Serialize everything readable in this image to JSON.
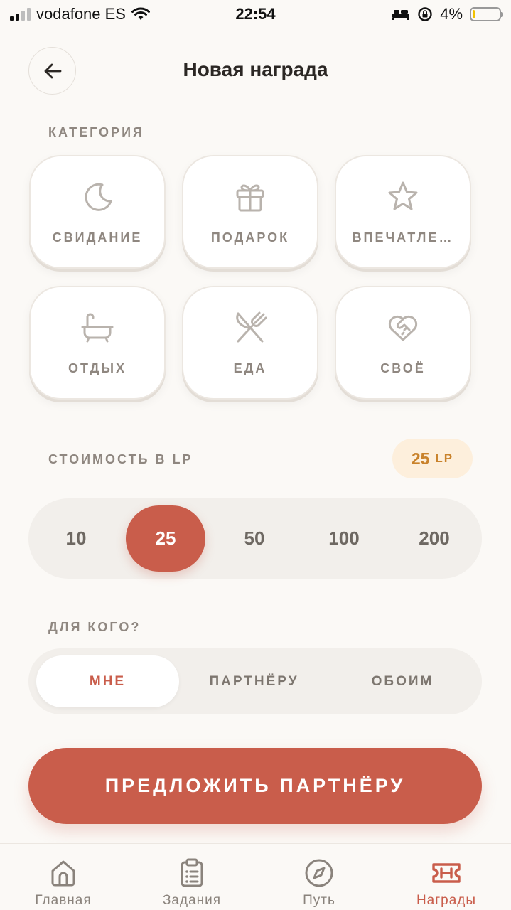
{
  "status_bar": {
    "carrier": "vodafone ES",
    "time": "22:54",
    "battery": "4%"
  },
  "header": {
    "title": "Новая награда",
    "back_icon": "arrow-left-icon"
  },
  "category": {
    "label": "КАТЕГОРИЯ",
    "items": [
      {
        "label": "СВИДАНИЕ",
        "icon": "moon-icon"
      },
      {
        "label": "ПОДАРОК",
        "icon": "gift-icon"
      },
      {
        "label": "ВПЕЧАТЛЕ…",
        "icon": "star-icon"
      },
      {
        "label": "ОТДЫХ",
        "icon": "bathtub-icon"
      },
      {
        "label": "ЕДА",
        "icon": "utensils-icon"
      },
      {
        "label": "СВОЁ",
        "icon": "heart-handshake-icon"
      }
    ]
  },
  "cost": {
    "label": "СТОИМОСТЬ В LP",
    "badge_value": "25",
    "badge_unit": "LP",
    "options": [
      "10",
      "25",
      "50",
      "100",
      "200"
    ],
    "selected": "25"
  },
  "recipient": {
    "label": "ДЛЯ КОГО?",
    "options": [
      "МНЕ",
      "ПАРТНЁРУ",
      "ОБОИМ"
    ],
    "selected": "МНЕ"
  },
  "cta": {
    "label": "ПРЕДЛОЖИТЬ ПАРТНЁРУ"
  },
  "tabbar": {
    "items": [
      {
        "label": "Главная",
        "icon": "home-icon"
      },
      {
        "label": "Задания",
        "icon": "clipboard-icon"
      },
      {
        "label": "Путь",
        "icon": "compass-icon"
      },
      {
        "label": "Награды",
        "icon": "ticket-icon"
      }
    ],
    "active": "Награды"
  },
  "colors": {
    "accent": "#c95d4b",
    "badge_bg": "#fdefdc",
    "badge_text": "#c9822b",
    "muted": "#8f8780"
  }
}
